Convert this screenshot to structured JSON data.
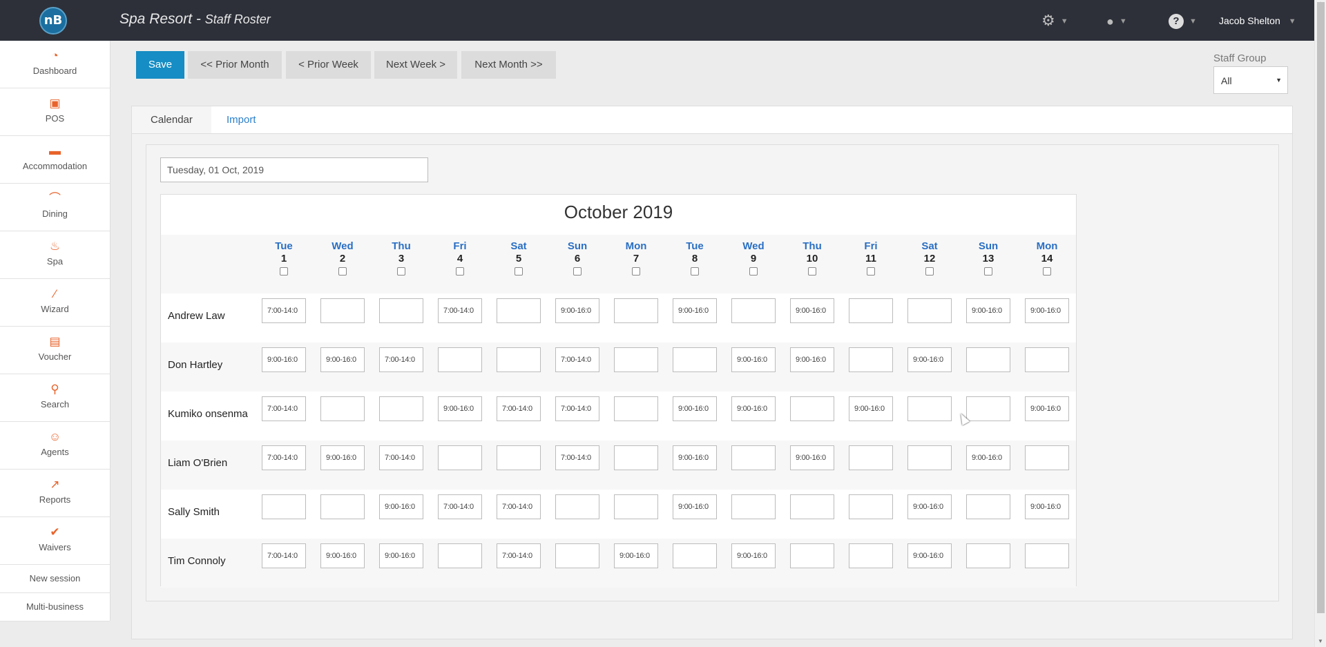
{
  "app": {
    "logo_text": "nB",
    "title": "Spa Resort - ",
    "subtitle": "Staff Roster",
    "user_name": "Jacob Shelton"
  },
  "sidebar": {
    "items": [
      {
        "label": "Dashboard",
        "icon": "dashboard-icon"
      },
      {
        "label": "POS",
        "icon": "pos-icon"
      },
      {
        "label": "Accommodation",
        "icon": "bed-icon"
      },
      {
        "label": "Dining",
        "icon": "dining-icon"
      },
      {
        "label": "Spa",
        "icon": "spa-icon"
      },
      {
        "label": "Wizard",
        "icon": "wand-icon"
      },
      {
        "label": "Voucher",
        "icon": "gift-icon"
      },
      {
        "label": "Search",
        "icon": "search-icon"
      },
      {
        "label": "Agents",
        "icon": "agent-icon"
      },
      {
        "label": "Reports",
        "icon": "chart-icon"
      },
      {
        "label": "Waivers",
        "icon": "check-icon"
      }
    ],
    "links": [
      "New session",
      "Multi-business"
    ]
  },
  "toolbar": {
    "save": "Save",
    "prior_month": "<< Prior Month",
    "prior_week": "< Prior Week",
    "next_week": "Next Week >",
    "next_month": "Next Month >>"
  },
  "staff_group": {
    "label": "Staff Group",
    "value": "All"
  },
  "tabs": {
    "calendar": "Calendar",
    "import": "Import"
  },
  "date_field": {
    "value": "Tuesday, 01 Oct, 2019"
  },
  "calendar": {
    "title": "October 2019",
    "days": [
      {
        "name": "Tue",
        "date": "1"
      },
      {
        "name": "Wed",
        "date": "2"
      },
      {
        "name": "Thu",
        "date": "3"
      },
      {
        "name": "Fri",
        "date": "4"
      },
      {
        "name": "Sat",
        "date": "5"
      },
      {
        "name": "Sun",
        "date": "6"
      },
      {
        "name": "Mon",
        "date": "7"
      },
      {
        "name": "Tue",
        "date": "8"
      },
      {
        "name": "Wed",
        "date": "9"
      },
      {
        "name": "Thu",
        "date": "10"
      },
      {
        "name": "Fri",
        "date": "11"
      },
      {
        "name": "Sat",
        "date": "12"
      },
      {
        "name": "Sun",
        "date": "13"
      },
      {
        "name": "Mon",
        "date": "14"
      }
    ],
    "staff": [
      {
        "name": "Andrew Law",
        "shifts": [
          "7:00-14:0",
          "",
          "",
          "7:00-14:0",
          "",
          "9:00-16:0",
          "",
          "9:00-16:0",
          "",
          "9:00-16:0",
          "",
          "",
          "9:00-16:0",
          "9:00-16:0"
        ]
      },
      {
        "name": "Don Hartley",
        "shifts": [
          "9:00-16:0",
          "9:00-16:0",
          "7:00-14:0",
          "",
          "",
          "7:00-14:0",
          "",
          "",
          "9:00-16:0",
          "9:00-16:0",
          "",
          "9:00-16:0",
          "",
          ""
        ]
      },
      {
        "name": "Kumiko onsenma",
        "shifts": [
          "7:00-14:0",
          "",
          "",
          "9:00-16:0",
          "7:00-14:0",
          "7:00-14:0",
          "",
          "9:00-16:0",
          "9:00-16:0",
          "",
          "9:00-16:0",
          "",
          "",
          "9:00-16:0"
        ]
      },
      {
        "name": "Liam O'Brien",
        "shifts": [
          "7:00-14:0",
          "9:00-16:0",
          "7:00-14:0",
          "",
          "",
          "7:00-14:0",
          "",
          "9:00-16:0",
          "",
          "9:00-16:0",
          "",
          "",
          "9:00-16:0",
          ""
        ]
      },
      {
        "name": "Sally Smith",
        "shifts": [
          "",
          "",
          "9:00-16:0",
          "7:00-14:0",
          "7:00-14:0",
          "",
          "",
          "9:00-16:0",
          "",
          "",
          "",
          "9:00-16:0",
          "",
          "9:00-16:0"
        ]
      },
      {
        "name": "Tim Connoly",
        "shifts": [
          "7:00-14:0",
          "9:00-16:0",
          "9:00-16:0",
          "",
          "7:00-14:0",
          "",
          "9:00-16:0",
          "",
          "9:00-16:0",
          "",
          "",
          "9:00-16:0",
          "",
          ""
        ]
      }
    ]
  }
}
